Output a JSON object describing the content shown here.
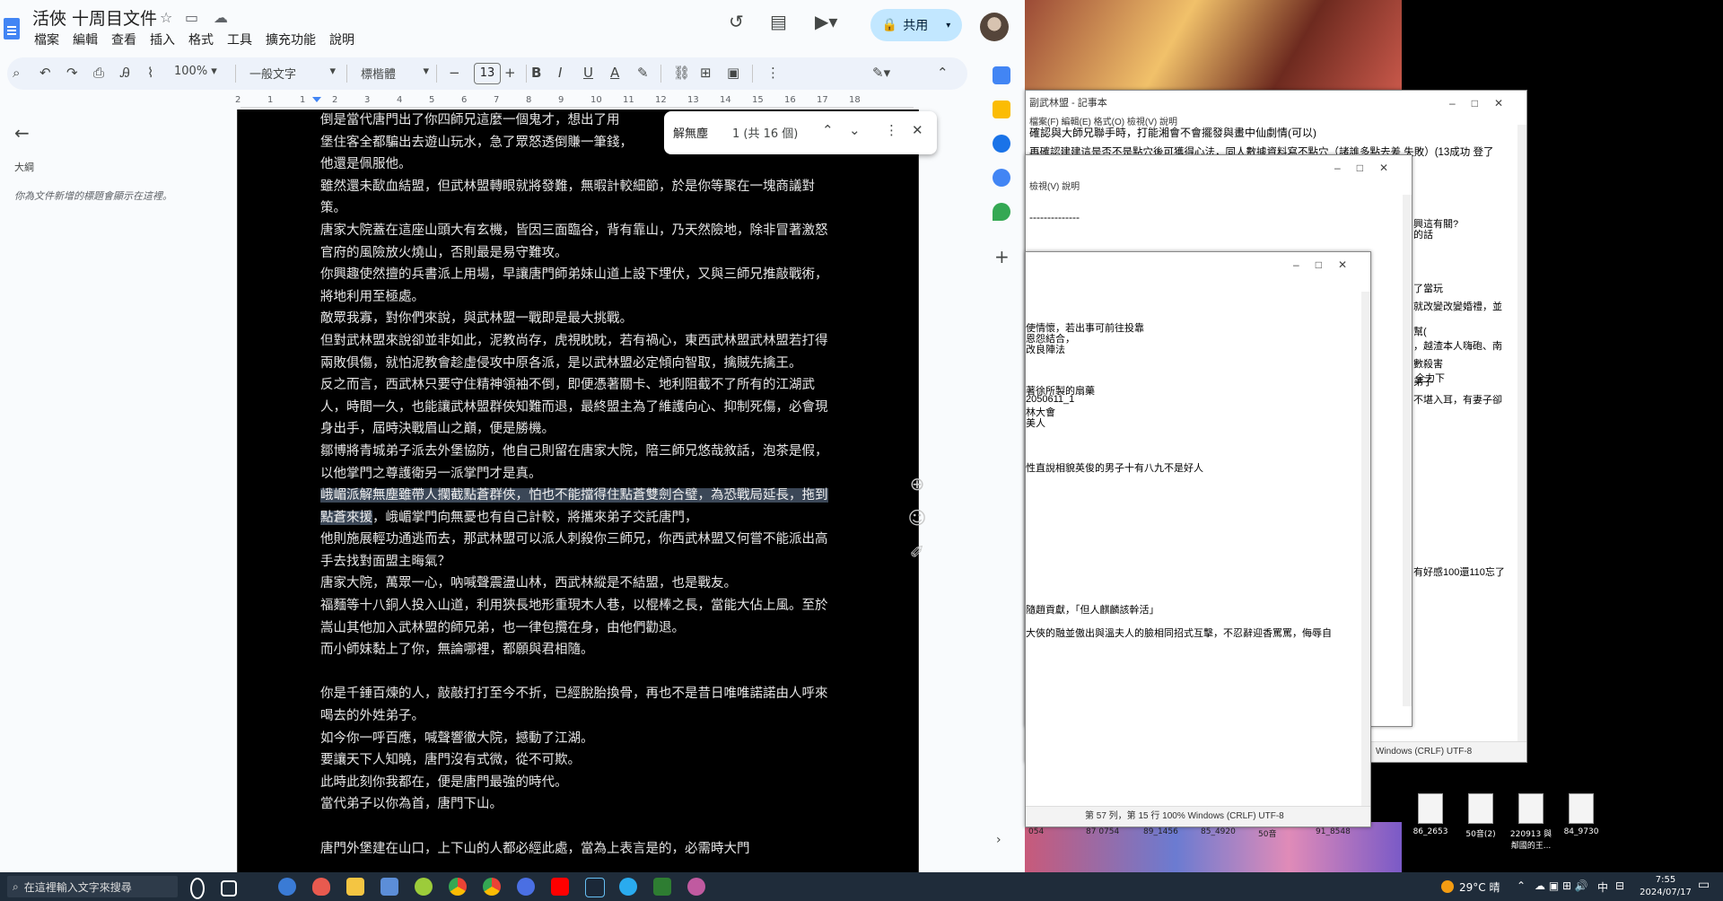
{
  "docs": {
    "title": "活俠 十周目文件",
    "menu": [
      "檔案",
      "編輯",
      "查看",
      "插入",
      "格式",
      "工具",
      "擴充功能",
      "說明"
    ],
    "share_label": "共用",
    "zoom": "100%",
    "style": "一般文字",
    "font": "標楷體",
    "font_size": "13",
    "outline_title": "大綱",
    "outline_hint": "你為文件新增的標題會顯示在這裡。",
    "ruler_ticks": [
      "2",
      "1",
      "1",
      "2",
      "3",
      "4",
      "5",
      "6",
      "7",
      "8",
      "9",
      "10",
      "11",
      "12",
      "13",
      "14",
      "15",
      "16",
      "17",
      "18"
    ],
    "find": {
      "query": "解無塵",
      "count": "1 (共 16 個)"
    },
    "paragraphs": [
      "倒是當代唐門出了你四師兄這麼一個鬼才，想出了用",
      "堡住客全都騙出去遊山玩水，急了眾怒透倒賺一筆錢，",
      "他還是佩服他。",
      "雖然還未歃血結盟，但武林盟轉眼就將發難，無暇計較細節，於是你等聚在一塊商議對策。",
      "唐家大院蓋在這座山頭大有玄機，皆因三面臨谷，背有靠山，乃天然險地，除非冒著激怒官府的風險放火燒山，否則最是易守難攻。",
      "你興趣使然擅的兵書派上用場，早讓唐門師弟妹山道上設下埋伏，又與三師兄推敲戰術，將地利用至極處。",
      "敵眾我寡，對你們來說，與武林盟一戰即是最大挑戰。",
      "但對武林盟來說卻並非如此，泥教尚存，虎視眈眈，若有禍心，東西武林盟武林盟若打得兩敗俱傷，就怕泥教會趁虛侵攻中原各派，是以武林盟必定傾向智取，擒賊先擒王。",
      "反之而言，西武林只要守住精神領袖不倒，即便憑著關卡、地利阻截不了所有的江湖武人，時間一久，也能讓武林盟群俠知難而退，最終盟主為了維護向心、抑制死傷，必會現身出手，屆時決戰眉山之巔，便是勝機。",
      "鄒博將青城弟子派去外堡協防，他自己則留在唐家大院，陪三師兄悠哉敘話，泡茶是假，以他掌門之尊護衛另一派掌門才是真。"
    ],
    "highlight_prefix": "峨嵋派解無塵雖帶人攔截點蒼群俠，怕也不能擋得住點蒼雙劍合璧，為恐戰局延長，拖到點蒼來援",
    "highlight_suffix": "，峨嵋掌門向無憂也有自己計較，將攜來弟子交託唐門，",
    "paragraphs2": [
      "他則施展輕功通逃而去，那武林盟可以派人刺殺你三師兄，你西武林盟又何嘗不能派出高手去找對面盟主晦氣？",
      "唐家大院，萬眾一心，吶喊聲震盪山林，西武林縱是不結盟，也是戰友。",
      "福麵等十八銅人投入山道，利用狹長地形重現木人巷，以棍棒之長，當能大佔上風。至於嵩山其他加入武林盟的師兄弟，也一律包攬在身，由他們勸退。",
      "而小師妹黏上了你，無論哪裡，都願與君相隨。",
      "",
      "你是千錘百煉的人，敲敲打打至今不折，已經脫胎換骨，再也不是昔日唯唯諾諾由人呼來喝去的外姓弟子。",
      "如今你一呼百應，喊聲響徹大院，撼動了江湖。",
      "要讓天下人知曉，唐門沒有式微，從不可欺。",
      "此時此刻你我都在，便是唐門最強的時代。",
      "當代弟子以你為首，唐門下山。",
      "",
      "唐門外堡建在山口，上下山的人都必經此處，當為上表言是的，必需時大門"
    ]
  },
  "notepads": {
    "w1": {
      "title": "副武林盟 - 記事本",
      "menu": "檔案(F)  編輯(E)  格式(O)  檢視(V)  說明",
      "lines": [
        "確認與大師兄聯手時，打能湘會不會擺發與畫中仙劇情(可以)",
        "再確認建建這是否不是點穴後可獲得心法，同人數據資料寫不點穴（諸誰多點去差 失敗）(13成功 登了"
      ],
      "right_lines": [
        "興這有關?",
        "的話",
        "了當玩",
        "就改變改變婚禮，並",
        "幫(",
        "，越渣本人嗨砲、南",
        "數殺害",
        "弟子",
        "不堪入耳，有妻子卻",
        "全力下",
        "有好感100還110忘了"
      ],
      "status": "Windows (CRLF)     UTF-8"
    },
    "w2": {
      "menu": "檢視(V)  說明",
      "dash": "--------------"
    },
    "w3": {
      "lines": [
        "使情懷，若出事可前往投靠",
        "恩怨結合，",
        "改良陣法",
        "著徐所製的扇藥",
        "2050611_1",
        "林大會",
        "美人",
        "性直說相貌英俊的男子十有八九不是好人",
        "隨趙貢獻，「但人麒麟該幹活」",
        "大俠的融並傲出與溫夫人的臉相同招式互擊，不忍辭迎香罵罵，侮辱自"
      ],
      "status": "第 57 列，第 15 行        100%     Windows (CRLF)        UTF-8"
    }
  },
  "desktop_icons": [
    {
      "label": "86_2653"
    },
    {
      "label": "50音(2)"
    },
    {
      "label": "220913 與鄰國的王..."
    },
    {
      "label": "84_9730"
    }
  ],
  "wallpaper_labels": [
    "054",
    "87 0754",
    "89_1456",
    "85_4920",
    "50音",
    "91_8548"
  ],
  "taskbar": {
    "search_placeholder": "在這裡輸入文字來搜尋",
    "weather": "29°C 晴",
    "ime": "中",
    "time": "7:55",
    "date": "2024/07/17"
  },
  "colors": {
    "share_bg": "#c2e7ff",
    "highlight": "#3b4757",
    "taskbar": "#1f2c3a"
  }
}
